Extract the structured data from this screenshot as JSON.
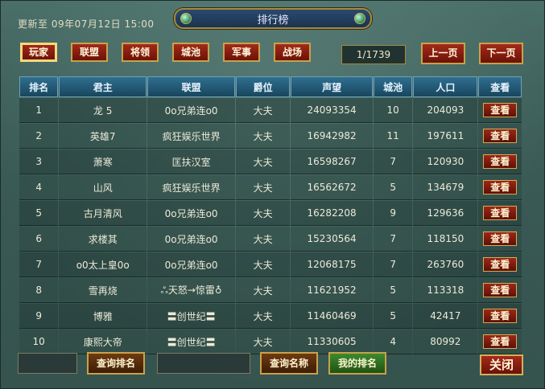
{
  "updated": "更新至 09年07月12日 15:00",
  "title": "排行榜",
  "tabs": [
    "玩家",
    "联盟",
    "将领",
    "城池",
    "军事",
    "战场"
  ],
  "active_tab": 0,
  "pager": {
    "current": "1/1739",
    "prev": "上一页",
    "next": "下一页"
  },
  "table": {
    "headers": [
      "排名",
      "君主",
      "联盟",
      "爵位",
      "声望",
      "城池",
      "人口",
      "查看"
    ],
    "view_label": "查看",
    "rows": [
      [
        "1",
        "龙 5",
        "0o兄弟连o0",
        "大夫",
        "24093354",
        "10",
        "204093"
      ],
      [
        "2",
        "英雄7",
        "疯狂娱乐世界",
        "大夫",
        "16942982",
        "11",
        "197611"
      ],
      [
        "3",
        "萧寒",
        "匡扶汉室",
        "大夫",
        "16598267",
        "7",
        "120930"
      ],
      [
        "4",
        "山风",
        "疯狂娱乐世界",
        "大夫",
        "16562672",
        "5",
        "134679"
      ],
      [
        "5",
        "古月清风",
        "0o兄弟连o0",
        "大夫",
        "16282208",
        "9",
        "129636"
      ],
      [
        "6",
        "求楼其",
        "0o兄弟连o0",
        "大夫",
        "15230564",
        "7",
        "118150"
      ],
      [
        "7",
        "o0太上皇0o",
        "0o兄弟连o0",
        "大夫",
        "12068175",
        "7",
        "263760"
      ],
      [
        "8",
        "雪再烧",
        "ஃ天怒→惊雷♁",
        "大夫",
        "11621952",
        "5",
        "113318"
      ],
      [
        "9",
        "博雅",
        "〓创世纪〓",
        "大夫",
        "11460469",
        "5",
        "42417"
      ],
      [
        "10",
        "康熙大帝",
        "〓创世纪〓",
        "大夫",
        "11330605",
        "4",
        "80992"
      ]
    ]
  },
  "bottom": {
    "query_rank": "查询排名",
    "query_name": "查询名称",
    "my_rank": "我的排名",
    "close": "关闭"
  }
}
